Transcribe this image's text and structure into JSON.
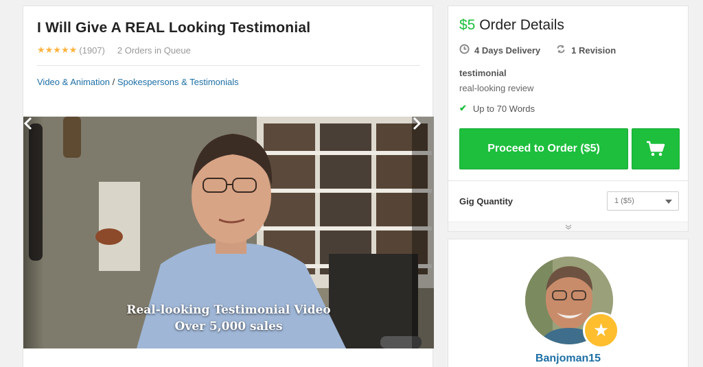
{
  "gig": {
    "title": "I Will Give A REAL Looking Testimonial",
    "stars": "★★★★★",
    "rating_count": "(1907)",
    "queue": "2 Orders in Queue",
    "breadcrumb": {
      "category": "Video & Animation",
      "separator": " / ",
      "subcategory": "Spokespersons & Testimonials"
    },
    "gallery": {
      "caption_line1": "Real-looking Testimonial Video",
      "caption_line2": "Over 5,000 sales",
      "prev_icon": "chevron-left-icon",
      "next_icon": "chevron-right-icon"
    }
  },
  "order": {
    "price": "$5",
    "heading": "Order Details",
    "delivery": "4 Days Delivery",
    "revisions": "1 Revision",
    "package_title": "testimonial",
    "package_desc": "real-looking review",
    "feature": "Up to 70 Words",
    "proceed_label": "Proceed to Order ($5)",
    "quantity_label": "Gig Quantity",
    "quantity_value": "1 ($5)"
  },
  "seller": {
    "username": "Banjoman15"
  },
  "colors": {
    "green": "#1dbf3d",
    "link": "#1d6fa5",
    "star": "#ffb33e",
    "badge": "#ffbe2e"
  }
}
